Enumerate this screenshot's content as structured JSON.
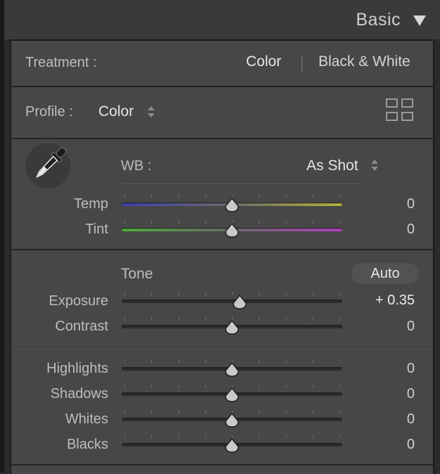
{
  "header": {
    "title": "Basic",
    "collapse_icon": "triangle-down-icon"
  },
  "treatment": {
    "label": "Treatment :",
    "options": [
      "Color",
      "Black & White"
    ],
    "active": "Color"
  },
  "profile": {
    "label": "Profile :",
    "value": "Color",
    "browser_icon": "grid-icon"
  },
  "wb": {
    "label": "WB :",
    "value": "As Shot",
    "picker_icon": "eyedropper-icon",
    "sliders": [
      {
        "label": "Temp",
        "value": "0",
        "level": 0.5
      },
      {
        "label": "Tint",
        "value": "0",
        "level": 0.5
      }
    ]
  },
  "tone": {
    "label": "Tone",
    "auto_label": "Auto",
    "sliders": [
      {
        "label": "Exposure",
        "value": "+ 0.35",
        "level": 0.535
      },
      {
        "label": "Contrast",
        "value": "0",
        "level": 0.5
      }
    ]
  },
  "presence": {
    "sliders": [
      {
        "label": "Highlights",
        "value": "0",
        "level": 0.5
      },
      {
        "label": "Shadows",
        "value": "0",
        "level": 0.5
      },
      {
        "label": "Whites",
        "value": "0",
        "level": 0.5
      },
      {
        "label": "Blacks",
        "value": "0",
        "level": 0.5
      }
    ]
  },
  "colors": {
    "temp_left": "#3f40b0",
    "temp_right": "#b5b33a",
    "tint_left": "#4fae3a",
    "tint_right": "#b23fc0"
  }
}
